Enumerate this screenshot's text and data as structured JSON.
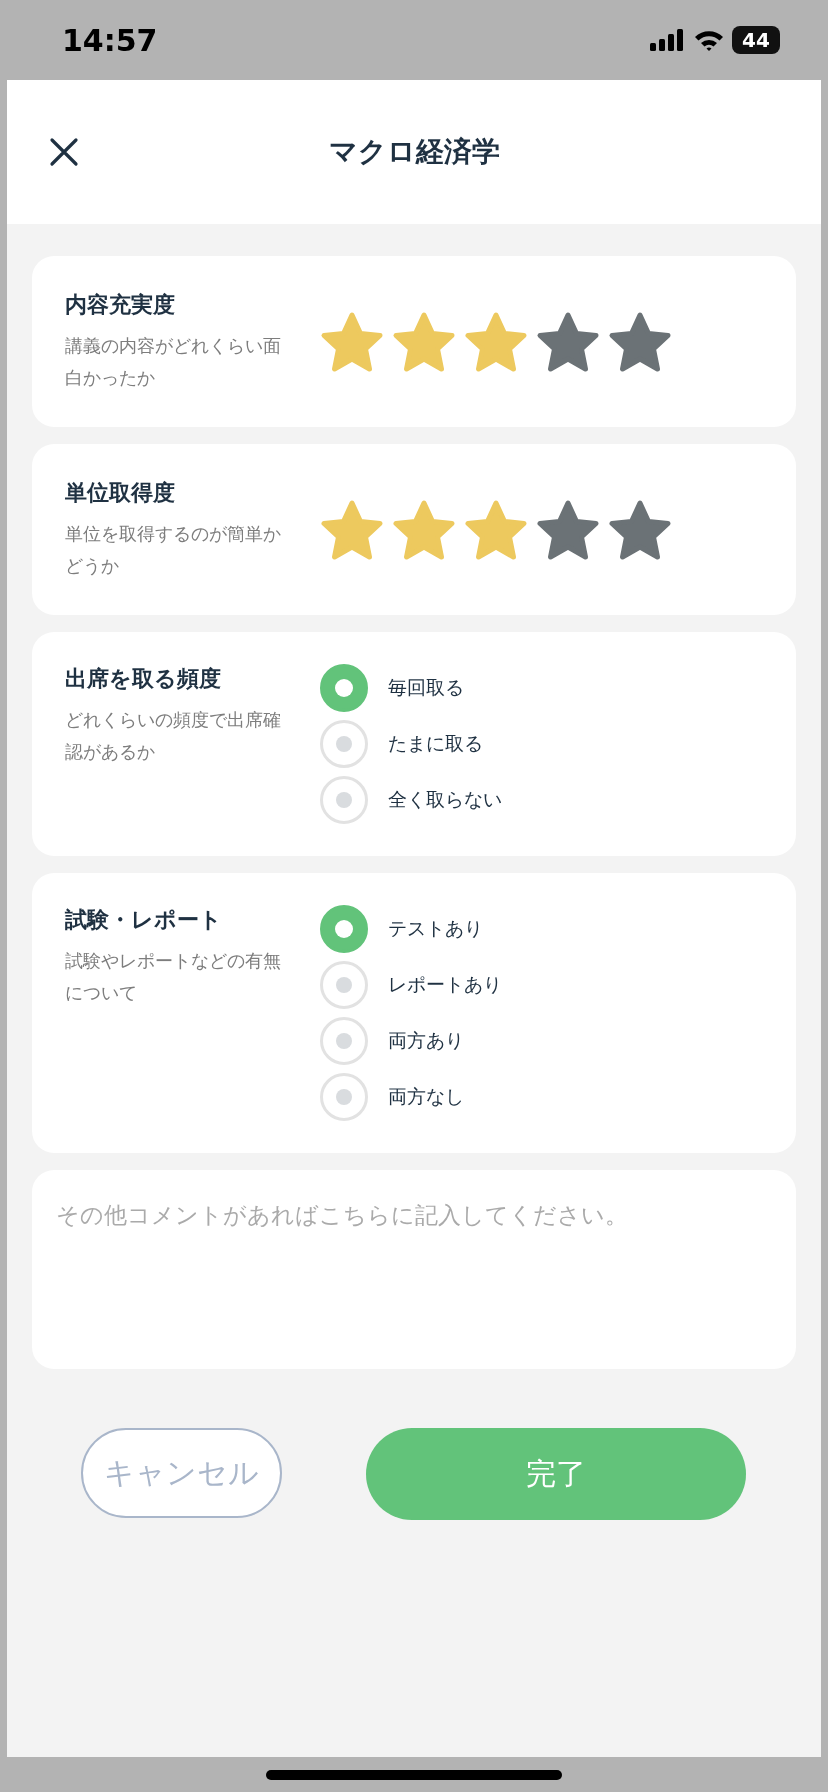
{
  "status_bar": {
    "time": "14:57",
    "battery": "44"
  },
  "header": {
    "title": "マクロ経済学"
  },
  "sections": [
    {
      "kind": "stars",
      "title": "内容充実度",
      "description": "講義の内容がどれくらい面白かったか",
      "stars": 3
    },
    {
      "kind": "stars",
      "title": "単位取得度",
      "description": "単位を取得するのが簡単かどうか",
      "stars": 3
    },
    {
      "kind": "radio",
      "title": "出席を取る頻度",
      "description": "どれくらいの頻度で出席確認があるか",
      "options": [
        {
          "label": "毎回取る",
          "selected": true
        },
        {
          "label": "たまに取る",
          "selected": false
        },
        {
          "label": "全く取らない",
          "selected": false
        }
      ]
    },
    {
      "kind": "radio",
      "title": "試験・レポート",
      "description": "試験やレポートなどの有無について",
      "options": [
        {
          "label": "テストあり",
          "selected": true
        },
        {
          "label": "レポートあり",
          "selected": false
        },
        {
          "label": "両方あり",
          "selected": false
        },
        {
          "label": "両方なし",
          "selected": false
        }
      ]
    }
  ],
  "comment": {
    "placeholder": "その他コメントがあればこちらに記入してください。"
  },
  "buttons": {
    "cancel": "キャンセル",
    "done": "完了"
  }
}
